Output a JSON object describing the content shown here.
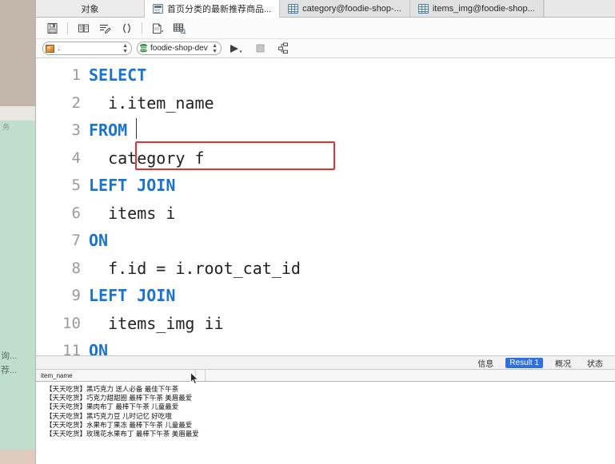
{
  "window": {
    "tabs": [
      {
        "label": "对象",
        "icon": "none",
        "active": false,
        "kind": "object-pane"
      },
      {
        "label": "首页分类的最新推荐商品...",
        "icon": "query-icon",
        "active": true,
        "kind": "query"
      },
      {
        "label": "category@foodie-shop-...",
        "icon": "table-icon",
        "active": false,
        "kind": "table"
      },
      {
        "label": "items_img@foodie-shop...",
        "icon": "table-icon",
        "active": false,
        "kind": "table"
      }
    ]
  },
  "toolbar": {
    "buttons": [
      {
        "name": "save-icon",
        "title": "保存"
      },
      {
        "name": "beautify-sql-icon",
        "title": "美化 SQL"
      },
      {
        "name": "edit-query-icon",
        "title": "编辑"
      },
      {
        "name": "parentheses-icon",
        "title": "()"
      },
      {
        "name": "explain-plan-icon",
        "title": "解释"
      },
      {
        "name": "query-builder-icon",
        "title": "查询创建工具"
      }
    ]
  },
  "connection_bar": {
    "schema_value": ".",
    "schema_placeholder": ".",
    "connection_value": "foodie-shop-dev",
    "run_label": "运行",
    "stop_label": "停止",
    "plan_label": "解释计划"
  },
  "editor": {
    "highlight_color": "#e8302f",
    "keyword_color": "#1a73cc",
    "lines": [
      {
        "no": "1",
        "indent": 0,
        "tokens": [
          {
            "t": "SELECT",
            "k": true
          }
        ]
      },
      {
        "no": "2",
        "indent": 1,
        "tokens": [
          {
            "t": "i.item_name",
            "k": false
          }
        ],
        "highlighted": true
      },
      {
        "no": "3",
        "indent": 0,
        "tokens": [
          {
            "t": "FROM",
            "k": true
          }
        ]
      },
      {
        "no": "4",
        "indent": 1,
        "tokens": [
          {
            "t": "category f",
            "k": false
          }
        ]
      },
      {
        "no": "5",
        "indent": 0,
        "tokens": [
          {
            "t": "LEFT JOIN",
            "k": true
          }
        ]
      },
      {
        "no": "6",
        "indent": 1,
        "tokens": [
          {
            "t": "items i",
            "k": false
          }
        ]
      },
      {
        "no": "7",
        "indent": 0,
        "tokens": [
          {
            "t": "ON",
            "k": true
          }
        ]
      },
      {
        "no": "8",
        "indent": 1,
        "tokens": [
          {
            "t": "f.id = i.root_cat_id",
            "k": false
          }
        ]
      },
      {
        "no": "9",
        "indent": 0,
        "tokens": [
          {
            "t": "LEFT JOIN",
            "k": true
          }
        ]
      },
      {
        "no": "10",
        "indent": 1,
        "tokens": [
          {
            "t": "items_img ii",
            "k": false
          }
        ]
      },
      {
        "no": "11",
        "indent": 0,
        "tokens": [
          {
            "t": "ON",
            "k": true
          }
        ]
      }
    ]
  },
  "results": {
    "tabs": [
      {
        "label": "信息",
        "active": false
      },
      {
        "label": "Result 1",
        "active": true
      },
      {
        "label": "概况",
        "active": false
      },
      {
        "label": "状态",
        "active": false
      }
    ],
    "active_tab_color": "#2f6fe0",
    "columns": [
      "item_name"
    ],
    "rows": [
      [
        "【天天吃货】黑巧克力 送人必备 最佳下午茶"
      ],
      [
        "【天天吃货】巧克力甜甜圈 最棒下午茶 美眉最爱"
      ],
      [
        "【天天吃货】果肉布丁 最棒下午茶 儿童最爱"
      ],
      [
        "【天天吃货】黑巧克力豆 儿时记忆 好吃哦"
      ],
      [
        "【天天吃货】水果布丁果冻 最棒下午茶 儿童最爱"
      ],
      [
        "【天天吃货】玫瑰花水果布丁 最棒下午茶 美眉最爱"
      ]
    ]
  },
  "background": {
    "ghost_texts": [
      "询...",
      "荐...",
      "务"
    ],
    "tan_color": "#c3b7ab",
    "mint_color": "#bfdfcc"
  }
}
